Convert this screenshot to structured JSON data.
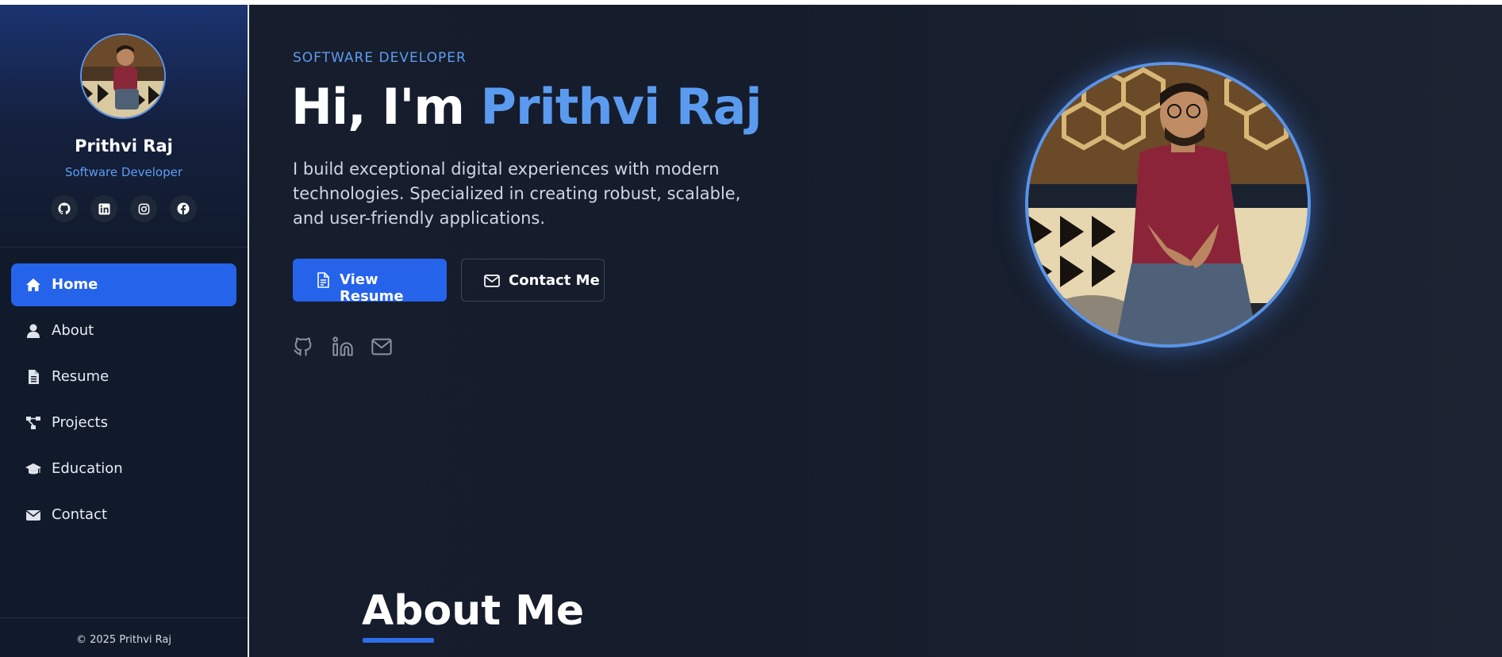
{
  "sidebar": {
    "name": "Prithvi Raj",
    "role": "Software Developer",
    "social": [
      {
        "icon": "github-icon"
      },
      {
        "icon": "linkedin-icon"
      },
      {
        "icon": "instagram-icon"
      },
      {
        "icon": "facebook-icon"
      }
    ],
    "nav": [
      {
        "label": "Home",
        "icon": "home-icon",
        "active": true
      },
      {
        "label": "About",
        "icon": "user-icon"
      },
      {
        "label": "Resume",
        "icon": "file-icon"
      },
      {
        "label": "Projects",
        "icon": "project-diagram-icon"
      },
      {
        "label": "Education",
        "icon": "graduation-cap-icon"
      },
      {
        "label": "Contact",
        "icon": "envelope-icon"
      }
    ],
    "footer": "© 2025 Prithvi Raj"
  },
  "hero": {
    "eyebrow": "SOFTWARE DEVELOPER",
    "greeting": "Hi, I'm ",
    "name": "Prithvi Raj",
    "description": "I build exceptional digital experiences with modern technologies. Specialized in creating robust, scalable, and user-friendly applications.",
    "primary_button": "View Resume",
    "secondary_button": "Contact Me",
    "social": [
      {
        "icon": "github-icon"
      },
      {
        "icon": "linkedin-icon"
      },
      {
        "icon": "mail-icon"
      }
    ]
  },
  "about": {
    "title": "About Me"
  },
  "colors": {
    "accent": "#5a9bf0",
    "primary_button": "#2563eb",
    "background": "#121a2b"
  }
}
